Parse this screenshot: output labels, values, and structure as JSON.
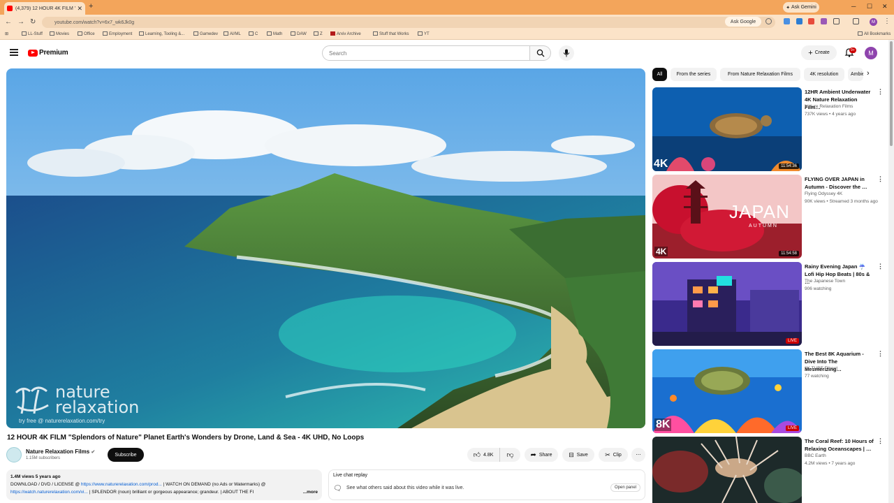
{
  "browser": {
    "tab_title": "(4,379) 12 HOUR 4K FILM \"Spl…",
    "new_tab": "+",
    "ask_gemini": "Ask Gemini",
    "url": "youtube.com/watch?v=6x7_wk6Jk0g",
    "ask_google": "Ask Google",
    "profile_letter": "M",
    "bookmarks": [
      "LL-Stuff",
      "Movies",
      "Office",
      "Employment",
      "Learning, Tooling &...",
      "Gamedev",
      "AI/ML",
      "C",
      "Math",
      "DAW",
      "Z",
      "Arxiv Archive",
      "Stuff that Works",
      "YT"
    ],
    "all_bookmarks": "All Bookmarks"
  },
  "header": {
    "logo_text": "Premium",
    "search_placeholder": "Search",
    "create_label": "Create",
    "notification_count": "9+",
    "avatar_letter": "M"
  },
  "video": {
    "title": "12 HOUR 4K FILM \"Splendors of Nature\" Planet Earth's Wonders by Drone, Land & Sea - 4K UHD, No Loops",
    "watermark_line1": "nature",
    "watermark_line2": "relaxation",
    "watermark_sub": "try free @ naturerelaxation.com/try",
    "channel": "Nature Relaxation Films",
    "subscribers": "1.15M subscribers",
    "subscribe_label": "Subscribe",
    "likes": "4.8K",
    "share_label": "Share",
    "save_label": "Save",
    "clip_label": "Clip",
    "more_actions": "⋯"
  },
  "description": {
    "views": "1.4M views  5 years ago",
    "line1_prefix": "DOWNLOAD / DVD / LICENSE @ ",
    "line1_link": "https://www.naturerelaxation.com/prod...",
    "line1_suffix": " | WATCH ON DEMAND (no Ads or Watermarks) @",
    "line2_link": "https://watch.naturerelaxation.com/vi...",
    "line2_suffix": " | SPLENDOR (noun) brilliant or gorgeous appearance; grandeur. | ABOUT THE FI",
    "more": "...more"
  },
  "chat": {
    "title": "Live chat replay",
    "text": "See what others said about this video while it was live.",
    "open_panel": "Open panel"
  },
  "chips": [
    "All",
    "From the series",
    "From Nature Relaxation Films",
    "4K resolution",
    "Ambient"
  ],
  "recommendations": [
    {
      "title": "12HR Ambient Underwater 4K Nature Relaxation Film…",
      "channel": "Nature Relaxation Films",
      "meta": "737K views • 4 years ago",
      "duration": "11:54:36",
      "badge": "4K"
    },
    {
      "title": "FLYING OVER JAPAN in Autumn - Discover the …",
      "channel": "Flying Odyssey 4K",
      "meta": "90K views • Streamed 3 months ago",
      "duration": "11:54:58",
      "badge": "4K",
      "overlay_big": "JAPAN",
      "overlay_small": "AUTUMN"
    },
    {
      "title": "Rainy Evening Japan ☔ Lofi Hip Hop Beats | 80s & …",
      "channel": "The Japanese Town",
      "meta": "906 watching",
      "duration": "LIVE",
      "badge": ""
    },
    {
      "title": "The Best 8K Aquarium - Dive Into The Mesmerizing…",
      "channel": "8K TUBE Planet",
      "meta": "77 watching",
      "duration": "LIVE",
      "badge": "8K"
    },
    {
      "title": "The Coral Reef: 10 Hours of Relaxing Oceanscapes | …",
      "channel": "BBC Earth",
      "meta": "4.2M views • 7 years ago",
      "duration": "",
      "badge": ""
    }
  ],
  "colors": {
    "brand_red": "#ff0000",
    "browser_frame": "#f3a55b",
    "link_blue": "#065fd4"
  }
}
